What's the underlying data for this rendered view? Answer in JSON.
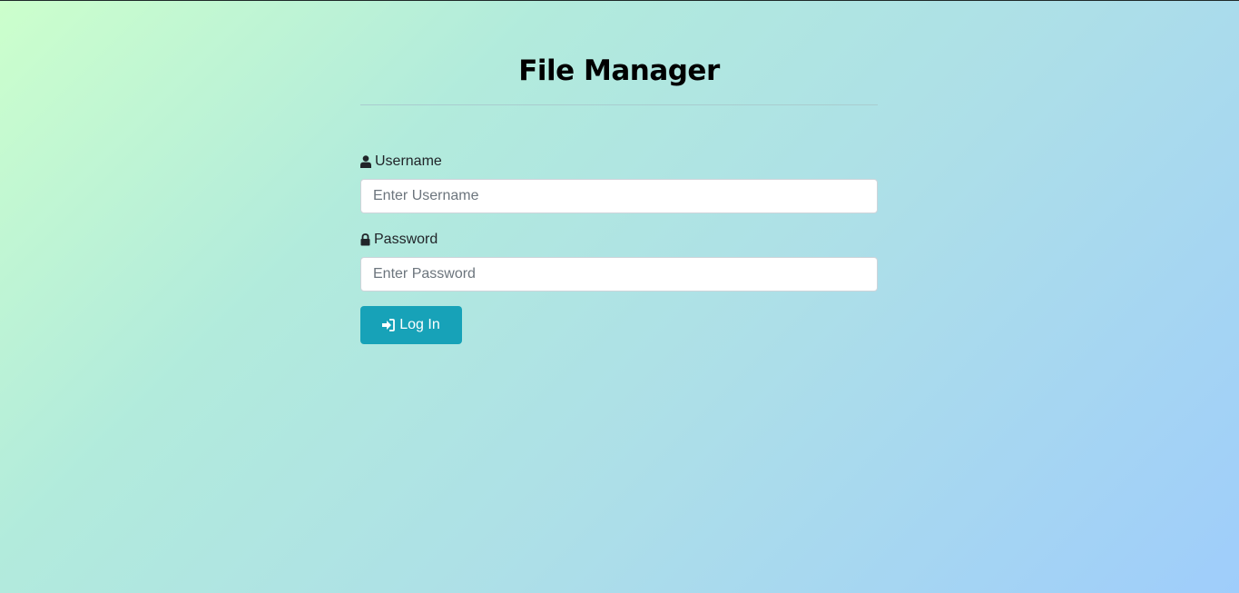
{
  "page": {
    "title": "File Manager"
  },
  "form": {
    "username": {
      "icon": "user-icon",
      "label": "Username",
      "placeholder": "Enter Username",
      "value": ""
    },
    "password": {
      "icon": "lock-icon",
      "label": "Password",
      "placeholder": "Enter Password",
      "value": ""
    },
    "submit": {
      "icon": "sign-in-icon",
      "label": "Log In"
    }
  },
  "colors": {
    "button": "#17a2b8",
    "gradient_start": "#ccffcc",
    "gradient_end": "#9fcdfb"
  }
}
